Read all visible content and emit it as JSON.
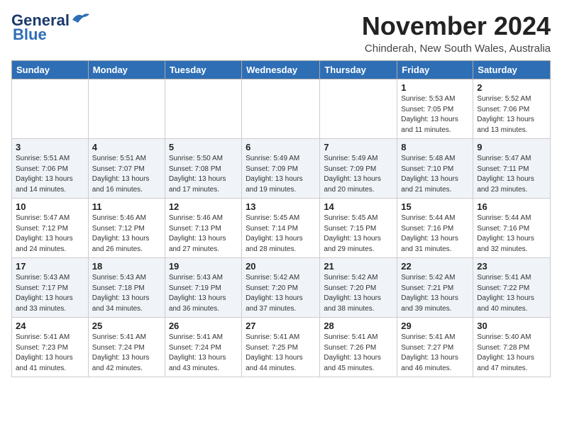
{
  "logo": {
    "line1": "General",
    "line2": "Blue"
  },
  "header": {
    "month": "November 2024",
    "location": "Chinderah, New South Wales, Australia"
  },
  "weekdays": [
    "Sunday",
    "Monday",
    "Tuesday",
    "Wednesday",
    "Thursday",
    "Friday",
    "Saturday"
  ],
  "weeks": [
    [
      {
        "day": "",
        "info": ""
      },
      {
        "day": "",
        "info": ""
      },
      {
        "day": "",
        "info": ""
      },
      {
        "day": "",
        "info": ""
      },
      {
        "day": "",
        "info": ""
      },
      {
        "day": "1",
        "info": "Sunrise: 5:53 AM\nSunset: 7:05 PM\nDaylight: 13 hours and 11 minutes."
      },
      {
        "day": "2",
        "info": "Sunrise: 5:52 AM\nSunset: 7:06 PM\nDaylight: 13 hours and 13 minutes."
      }
    ],
    [
      {
        "day": "3",
        "info": "Sunrise: 5:51 AM\nSunset: 7:06 PM\nDaylight: 13 hours and 14 minutes."
      },
      {
        "day": "4",
        "info": "Sunrise: 5:51 AM\nSunset: 7:07 PM\nDaylight: 13 hours and 16 minutes."
      },
      {
        "day": "5",
        "info": "Sunrise: 5:50 AM\nSunset: 7:08 PM\nDaylight: 13 hours and 17 minutes."
      },
      {
        "day": "6",
        "info": "Sunrise: 5:49 AM\nSunset: 7:09 PM\nDaylight: 13 hours and 19 minutes."
      },
      {
        "day": "7",
        "info": "Sunrise: 5:49 AM\nSunset: 7:09 PM\nDaylight: 13 hours and 20 minutes."
      },
      {
        "day": "8",
        "info": "Sunrise: 5:48 AM\nSunset: 7:10 PM\nDaylight: 13 hours and 21 minutes."
      },
      {
        "day": "9",
        "info": "Sunrise: 5:47 AM\nSunset: 7:11 PM\nDaylight: 13 hours and 23 minutes."
      }
    ],
    [
      {
        "day": "10",
        "info": "Sunrise: 5:47 AM\nSunset: 7:12 PM\nDaylight: 13 hours and 24 minutes."
      },
      {
        "day": "11",
        "info": "Sunrise: 5:46 AM\nSunset: 7:12 PM\nDaylight: 13 hours and 26 minutes."
      },
      {
        "day": "12",
        "info": "Sunrise: 5:46 AM\nSunset: 7:13 PM\nDaylight: 13 hours and 27 minutes."
      },
      {
        "day": "13",
        "info": "Sunrise: 5:45 AM\nSunset: 7:14 PM\nDaylight: 13 hours and 28 minutes."
      },
      {
        "day": "14",
        "info": "Sunrise: 5:45 AM\nSunset: 7:15 PM\nDaylight: 13 hours and 29 minutes."
      },
      {
        "day": "15",
        "info": "Sunrise: 5:44 AM\nSunset: 7:16 PM\nDaylight: 13 hours and 31 minutes."
      },
      {
        "day": "16",
        "info": "Sunrise: 5:44 AM\nSunset: 7:16 PM\nDaylight: 13 hours and 32 minutes."
      }
    ],
    [
      {
        "day": "17",
        "info": "Sunrise: 5:43 AM\nSunset: 7:17 PM\nDaylight: 13 hours and 33 minutes."
      },
      {
        "day": "18",
        "info": "Sunrise: 5:43 AM\nSunset: 7:18 PM\nDaylight: 13 hours and 34 minutes."
      },
      {
        "day": "19",
        "info": "Sunrise: 5:43 AM\nSunset: 7:19 PM\nDaylight: 13 hours and 36 minutes."
      },
      {
        "day": "20",
        "info": "Sunrise: 5:42 AM\nSunset: 7:20 PM\nDaylight: 13 hours and 37 minutes."
      },
      {
        "day": "21",
        "info": "Sunrise: 5:42 AM\nSunset: 7:20 PM\nDaylight: 13 hours and 38 minutes."
      },
      {
        "day": "22",
        "info": "Sunrise: 5:42 AM\nSunset: 7:21 PM\nDaylight: 13 hours and 39 minutes."
      },
      {
        "day": "23",
        "info": "Sunrise: 5:41 AM\nSunset: 7:22 PM\nDaylight: 13 hours and 40 minutes."
      }
    ],
    [
      {
        "day": "24",
        "info": "Sunrise: 5:41 AM\nSunset: 7:23 PM\nDaylight: 13 hours and 41 minutes."
      },
      {
        "day": "25",
        "info": "Sunrise: 5:41 AM\nSunset: 7:24 PM\nDaylight: 13 hours and 42 minutes."
      },
      {
        "day": "26",
        "info": "Sunrise: 5:41 AM\nSunset: 7:24 PM\nDaylight: 13 hours and 43 minutes."
      },
      {
        "day": "27",
        "info": "Sunrise: 5:41 AM\nSunset: 7:25 PM\nDaylight: 13 hours and 44 minutes."
      },
      {
        "day": "28",
        "info": "Sunrise: 5:41 AM\nSunset: 7:26 PM\nDaylight: 13 hours and 45 minutes."
      },
      {
        "day": "29",
        "info": "Sunrise: 5:41 AM\nSunset: 7:27 PM\nDaylight: 13 hours and 46 minutes."
      },
      {
        "day": "30",
        "info": "Sunrise: 5:40 AM\nSunset: 7:28 PM\nDaylight: 13 hours and 47 minutes."
      }
    ]
  ]
}
